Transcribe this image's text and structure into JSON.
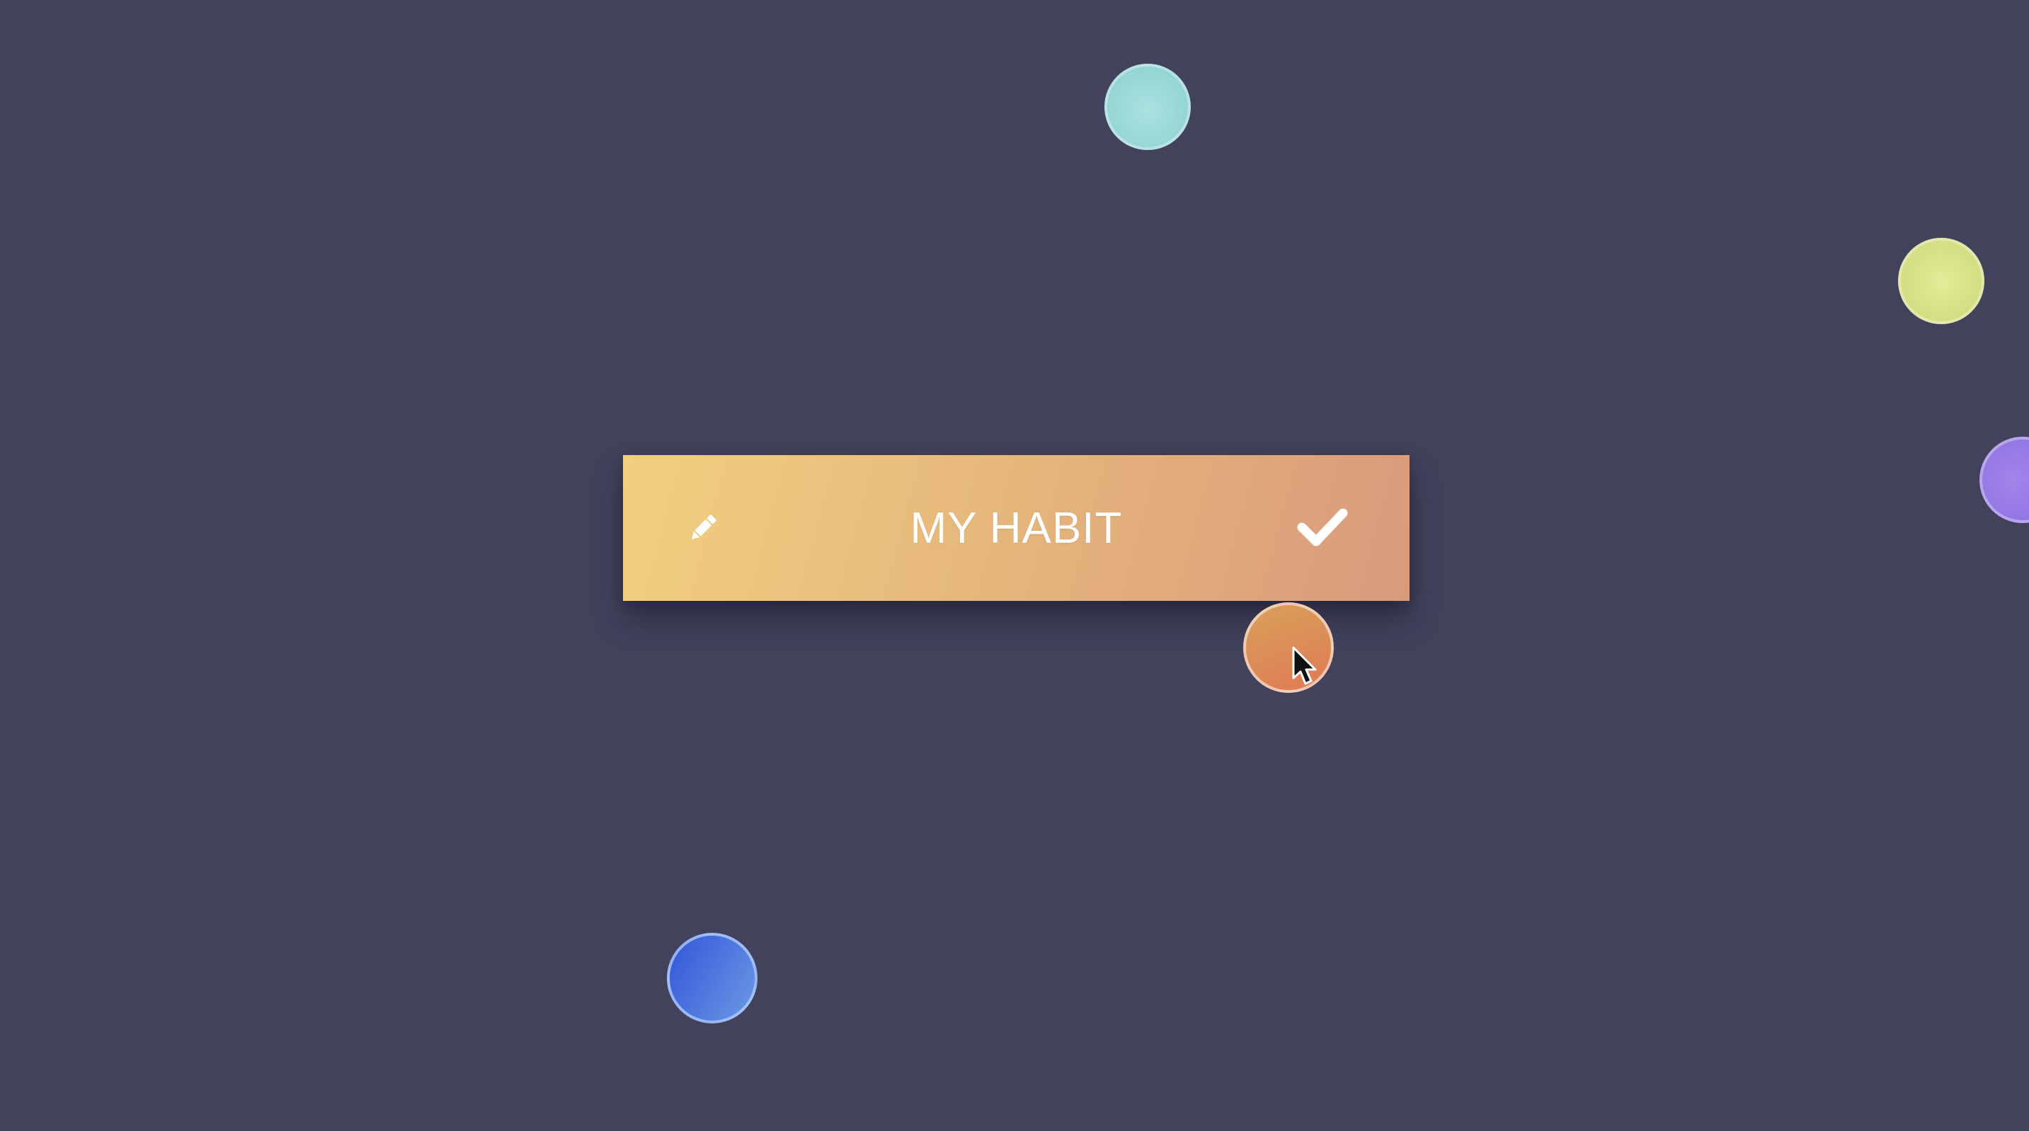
{
  "habit": {
    "title": "MY HABIT",
    "edit_icon": "pencil-icon",
    "complete_icon": "checkmark-icon",
    "gradient": [
      "#f1cf80",
      "#d99a7c"
    ]
  },
  "background_color": "#43425d",
  "bubbles": [
    {
      "name": "bubble-teal",
      "color": "#9ad8d8"
    },
    {
      "name": "bubble-lime",
      "color": "#d9e088"
    },
    {
      "name": "bubble-purple",
      "color": "#9479e5"
    },
    {
      "name": "bubble-orange",
      "color": "#dc8c57"
    },
    {
      "name": "bubble-blue",
      "color": "#4a72de"
    }
  ],
  "cursor_icon": "mouse-pointer-icon"
}
